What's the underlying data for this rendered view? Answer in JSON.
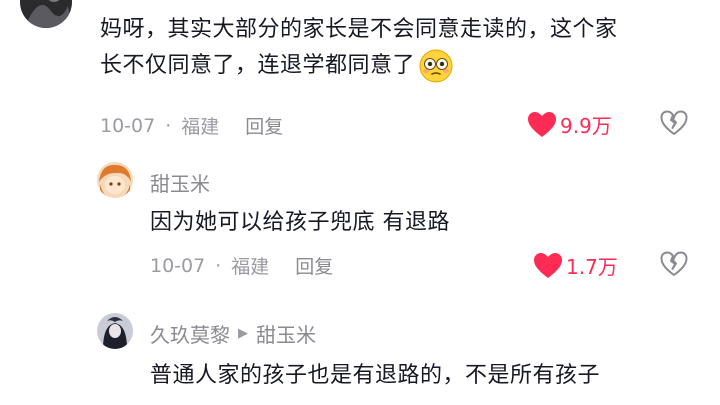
{
  "comment_main": {
    "username": "",
    "text_line1": "妈呀，其实大部分的家长是不会同意走读的，这个家",
    "text_line2": "长不仅同意了，连退学都同意了",
    "emoji": "flushed-face-emoji",
    "date": "10-07",
    "separator": "·",
    "location": "福建",
    "reply_label": "回复",
    "like_count": "9.9万"
  },
  "reply_1": {
    "username": "甜玉米",
    "text": "因为她可以给孩子兜底 有退路",
    "date": "10-07",
    "separator": "·",
    "location": "福建",
    "reply_label": "回复",
    "like_count": "1.7万"
  },
  "reply_2": {
    "username": "久玖莫黎",
    "reply_to_arrow": "▶",
    "reply_to": "甜玉米",
    "text": "普通人家的孩子也是有退路的，不是所有孩子"
  },
  "colors": {
    "like_red": "#fe2c55",
    "meta_gray": "#9a9ba3",
    "text_dark": "#161823"
  }
}
